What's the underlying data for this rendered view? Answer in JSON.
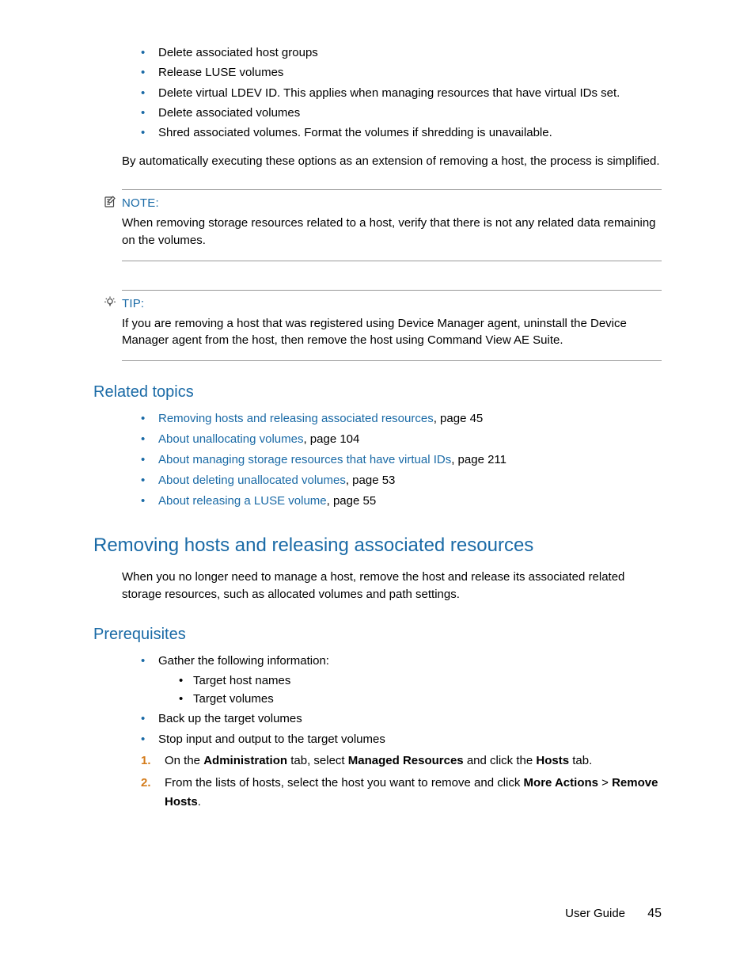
{
  "bullets_top": [
    "Delete associated host groups",
    "Release LUSE volumes",
    "Delete virtual LDEV ID. This applies when managing resources that have virtual IDs set.",
    "Delete associated volumes",
    "Shred associated volumes. Format the volumes if shredding is unavailable."
  ],
  "body_after_bullets": "By automatically executing these options as an extension of removing a host, the process is simplified.",
  "note": {
    "label": "NOTE:",
    "body": "When removing storage resources related to a host, verify that there is not any related data remaining on the volumes."
  },
  "tip": {
    "label": "TIP:",
    "body": "If you are removing a host that was registered using Device Manager agent, uninstall the Device Manager agent from the host, then remove the host using Command View AE Suite."
  },
  "related": {
    "heading": "Related topics",
    "items": [
      {
        "link": "Removing hosts and releasing associated resources",
        "suffix": ", page 45"
      },
      {
        "link": "About unallocating volumes",
        "suffix": ", page 104"
      },
      {
        "link": "About managing storage resources that have virtual IDs",
        "suffix": ", page 211"
      },
      {
        "link": "About deleting unallocated volumes",
        "suffix": ", page 53"
      },
      {
        "link": "About releasing a LUSE volume",
        "suffix": ", page 55"
      }
    ]
  },
  "section": {
    "heading": "Removing hosts and releasing associated resources",
    "intro": "When you no longer need to manage a host, remove the host and release its associated related storage resources, such as allocated volumes and path settings."
  },
  "prereq": {
    "heading": "Prerequisites",
    "items": [
      {
        "text": "Gather the following information:",
        "sub": [
          "Target host names",
          "Target volumes"
        ]
      },
      {
        "text": "Back up the target volumes"
      },
      {
        "text": "Stop input and output to the target volumes"
      }
    ]
  },
  "steps": [
    {
      "pre": "On the ",
      "b1": "Administration",
      "mid1": " tab, select ",
      "b2": "Managed Resources",
      "mid2": " and click the ",
      "b3": "Hosts",
      "post": " tab."
    },
    {
      "pre": "From the lists of hosts, select the host you want to remove and click ",
      "b1": "More Actions",
      "mid1": " > ",
      "b2": "Remove Hosts",
      "post": "."
    }
  ],
  "footer": {
    "label": "User Guide",
    "page": "45"
  }
}
